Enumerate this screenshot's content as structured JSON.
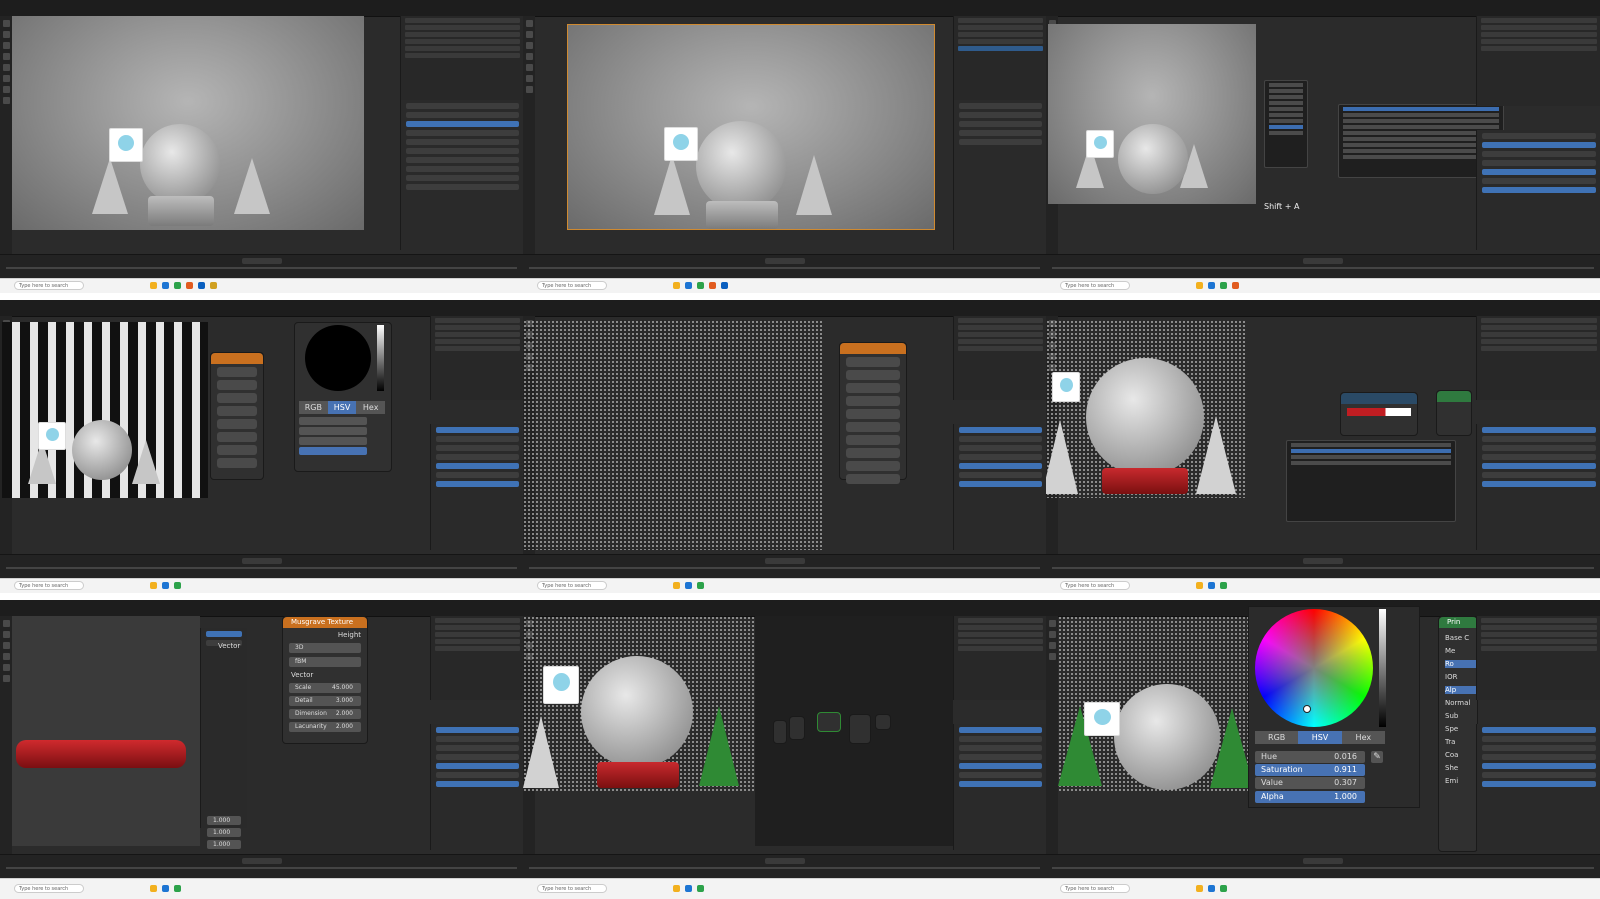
{
  "taskbar": {
    "search_placeholder": "Type here to search"
  },
  "panel_9_color_picker": {
    "tabs": [
      "RGB",
      "HSV",
      "Hex"
    ],
    "active_tab": "HSV",
    "fields": [
      {
        "label": "Hue",
        "value": "0.016"
      },
      {
        "label": "Saturation",
        "value": "0.911"
      },
      {
        "label": "Value",
        "value": "0.307"
      },
      {
        "label": "Alpha",
        "value": "1.000"
      }
    ]
  },
  "panel_3_shortcut": "Shift + A",
  "panel_7_node": {
    "title": "Musgrave Texture",
    "output": "Height",
    "input": "Vector",
    "dropdowns": [
      "3D",
      "fBM"
    ],
    "vector_label": "Vector",
    "fields": [
      {
        "label": "Scale",
        "value": "45.000"
      },
      {
        "label": "Detail",
        "value": "3.000"
      },
      {
        "label": "Dimension",
        "value": "2.000"
      },
      {
        "label": "Lacunarity",
        "value": "2.000"
      }
    ],
    "left_values": [
      "1.000",
      "1.000",
      "1.000"
    ]
  },
  "panel_4_picker": {
    "tabs": [
      "RGB",
      "HSV",
      "Hex"
    ]
  },
  "panel_9_side": [
    "Base C",
    "Me",
    "Ro",
    "IOR",
    "Alp",
    "Normal",
    "Sub",
    "Spe",
    "Tra",
    "Coa",
    "She",
    "Emi"
  ],
  "panel_9_side_header": "Prin",
  "colors": {
    "blender_bg": "#2b2b2b",
    "selection_blue": "#4772b3",
    "stripe_red": "#c01d22",
    "node_header_orange": "#c9701f"
  }
}
